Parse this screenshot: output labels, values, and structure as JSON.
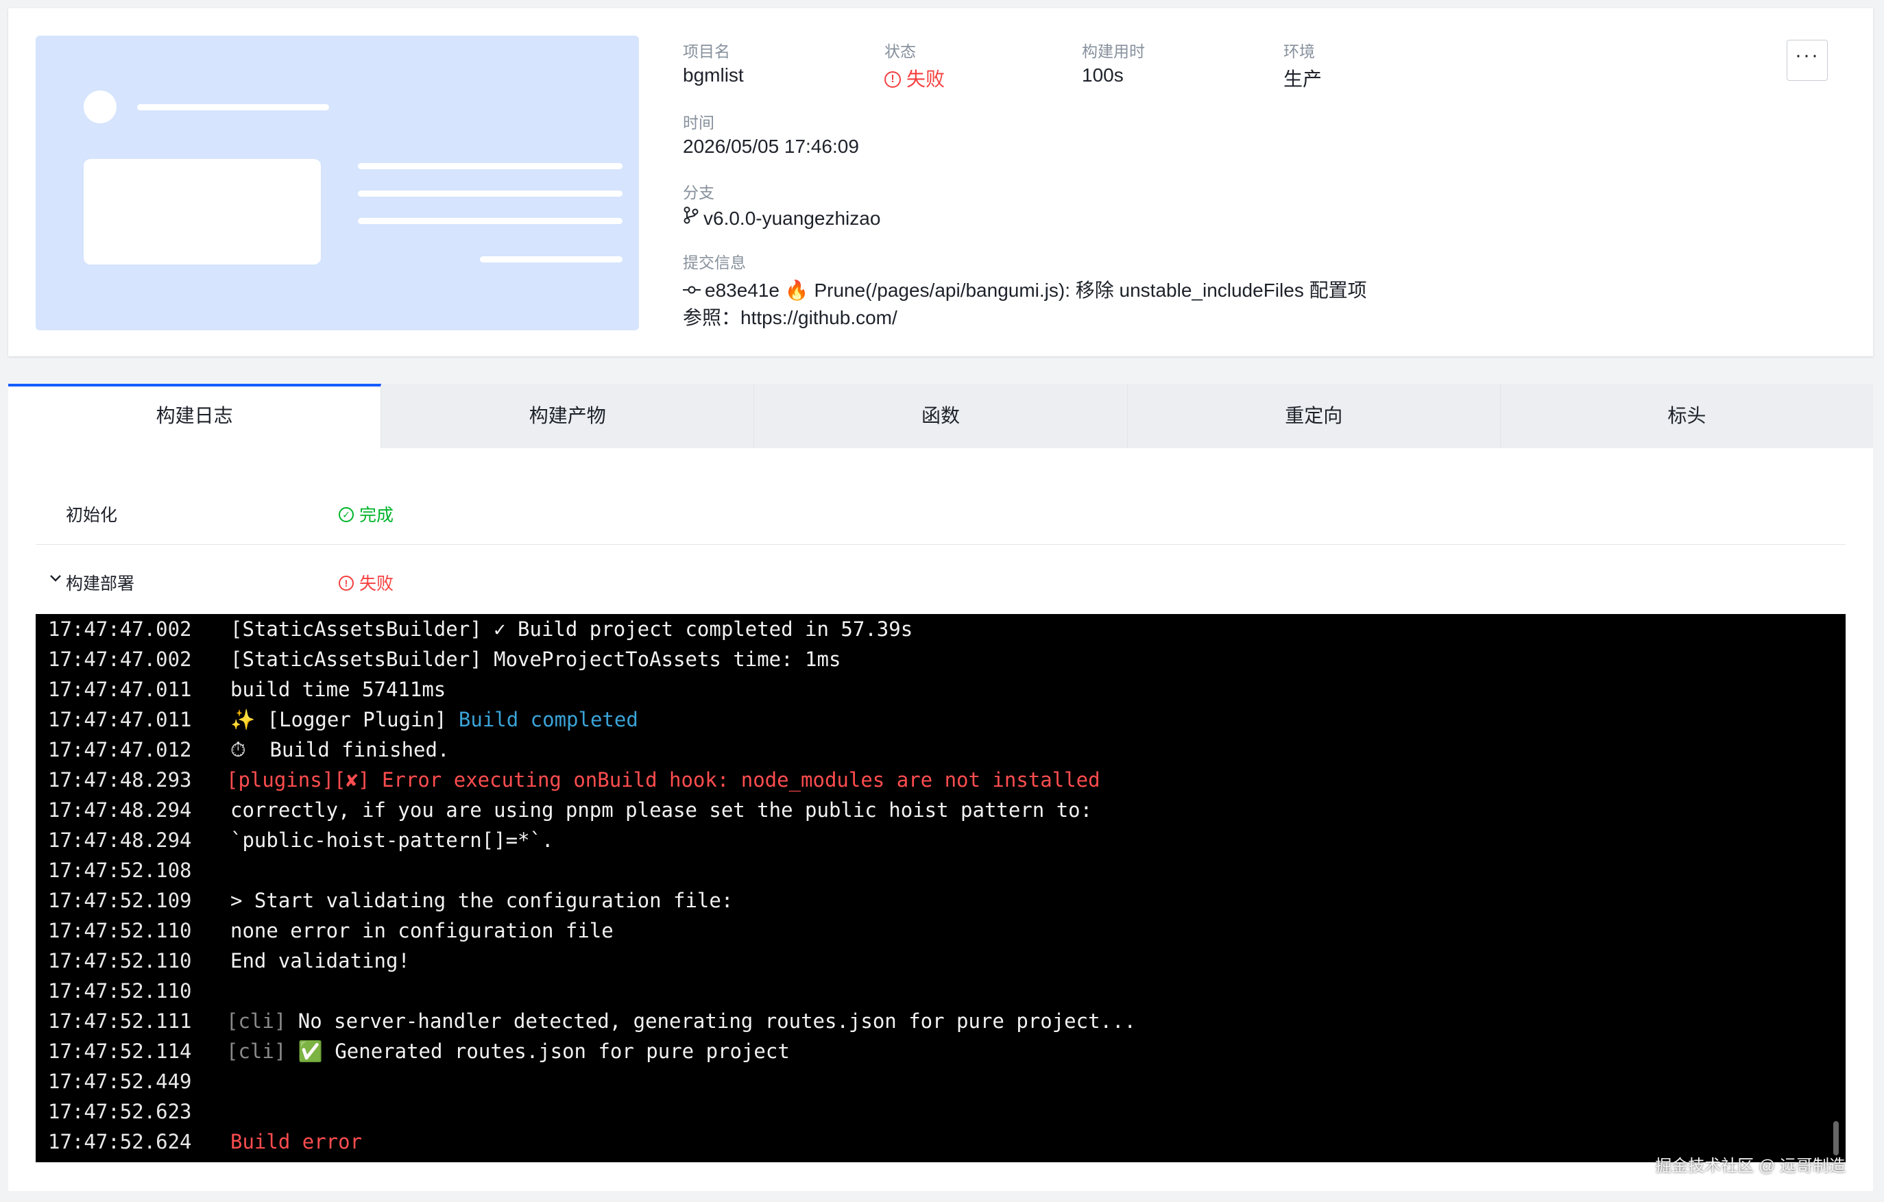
{
  "header": {
    "project_label": "项目名",
    "project_value": "bgmlist",
    "status_label": "状态",
    "status_value": "失败",
    "duration_label": "构建用时",
    "duration_value": "100s",
    "env_label": "环境",
    "env_value": "生产",
    "time_label": "时间",
    "time_value": "2026/05/05 17:46:09",
    "branch_label": "分支",
    "branch_value": "v6.0.0-yuangezhizao",
    "commit_label": "提交信息",
    "commit_hash": "e83e41e",
    "commit_message": "🔥 Prune(/pages/api/bangumi.js): 移除 unstable_includeFiles 配置项",
    "commit_ref": "参照：https://github.com/",
    "more_label": "···"
  },
  "tabs": [
    {
      "label": "构建日志",
      "active": true
    },
    {
      "label": "构建产物",
      "active": false
    },
    {
      "label": "函数",
      "active": false
    },
    {
      "label": "重定向",
      "active": false
    },
    {
      "label": "标头",
      "active": false
    }
  ],
  "stages": [
    {
      "name": "初始化",
      "status": "完成",
      "state": "success"
    },
    {
      "name": "构建部署",
      "status": "失败",
      "state": "failed"
    }
  ],
  "logs": [
    {
      "ts": "17:47:47.002",
      "msg": "[StaticAssetsBuilder] ✓ Build project completed in 57.39s",
      "style": "plain"
    },
    {
      "ts": "17:47:47.002",
      "msg": "[StaticAssetsBuilder] MoveProjectToAssets time: 1ms",
      "style": "plain"
    },
    {
      "ts": "17:47:47.011",
      "msg": "build time 57411ms",
      "style": "plain"
    },
    {
      "ts": "17:47:47.011",
      "prefix": "✨ [Logger Plugin] ",
      "msg": "Build completed",
      "style": "blue-suffix"
    },
    {
      "ts": "17:47:47.012",
      "msg": "⏱  Build finished.",
      "style": "plain"
    },
    {
      "ts": "17:47:48.293",
      "msg": "[plugins][✘] Error executing onBuild hook: node_modules are not installed",
      "style": "red",
      "indent": false
    },
    {
      "ts": "17:47:48.294",
      "msg": "correctly, if you are using pnpm please set the public hoist pattern to:",
      "style": "plain"
    },
    {
      "ts": "17:47:48.294",
      "msg": "`public-hoist-pattern[]=*`.",
      "style": "plain"
    },
    {
      "ts": "17:47:52.108",
      "msg": "",
      "style": "plain"
    },
    {
      "ts": "17:47:52.109",
      "msg": "> Start validating the configuration file:",
      "style": "plain"
    },
    {
      "ts": "17:47:52.110",
      "msg": "none error in configuration file",
      "style": "plain"
    },
    {
      "ts": "17:47:52.110",
      "msg": "End validating!",
      "style": "plain"
    },
    {
      "ts": "17:47:52.110",
      "msg": "",
      "style": "plain"
    },
    {
      "ts": "17:47:52.111",
      "prefix": "[cli]",
      "msg": " No server-handler detected, generating routes.json for pure project...",
      "style": "gray-prefix"
    },
    {
      "ts": "17:47:52.114",
      "prefix": "[cli]",
      "msg": " ✅ Generated routes.json for pure project",
      "style": "gray-prefix"
    },
    {
      "ts": "17:47:52.449",
      "msg": "",
      "style": "plain"
    },
    {
      "ts": "17:47:52.623",
      "msg": "",
      "style": "plain"
    },
    {
      "ts": "17:47:52.624",
      "msg": "Build error",
      "style": "red"
    }
  ],
  "watermark": "掘金技术社区 @ 远哥制造",
  "colors": {
    "accent": "#165dff",
    "error": "#f53f3f",
    "success": "#00b42a",
    "preview_bg": "#d6e4fd",
    "terminal_bg": "#000000"
  }
}
